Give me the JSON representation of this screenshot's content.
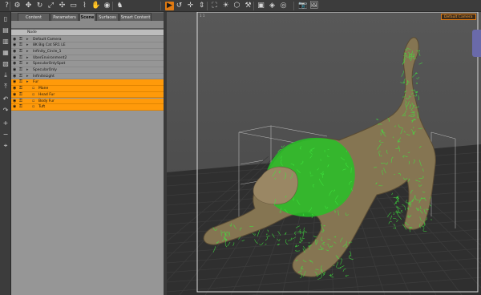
{
  "toolbar": {
    "icons": [
      "help-icon",
      "parameters-icon",
      "move-icon",
      "rotate-icon",
      "scale-icon",
      "universal-icon",
      "region-icon",
      "joint-icon",
      "grab-icon",
      "node-icon",
      "pose-icon",
      "active-tool-icon",
      "orbit-icon",
      "pan-icon",
      "dolly-icon",
      "frame-icon",
      "lights-icon",
      "render-icon",
      "render-settings-icon",
      "spot-render-icon",
      "iray-icon",
      "preview-icon",
      "camera-icon",
      "image-icon"
    ]
  },
  "left_strip": {
    "icons": [
      "new-scene-icon",
      "open-icon",
      "merge-icon",
      "save-icon",
      "save-as-icon",
      "import-icon",
      "export-icon",
      "undo-icon",
      "redo-icon",
      "zoom-in-icon",
      "zoom-out-icon",
      "fit-icon"
    ]
  },
  "tabs": [
    "Content Library",
    "Parameters",
    "Scene",
    "Surfaces",
    "Smart Content"
  ],
  "active_tab": "Scene",
  "scene": {
    "column_header": "Node",
    "rows": [
      {
        "label": "Default Camera",
        "indent": 0,
        "selected": false
      },
      {
        "label": "8K Big Cat SR1 LE",
        "indent": 0,
        "selected": false
      },
      {
        "label": "Infinity_Circle_1",
        "indent": 0,
        "selected": false
      },
      {
        "label": "UberEnvironment2",
        "indent": 0,
        "selected": false
      },
      {
        "label": "SpecularOnlySpot",
        "indent": 0,
        "selected": false
      },
      {
        "label": "SpecularOnly",
        "indent": 0,
        "selected": false
      },
      {
        "label": "InfiniteLight",
        "indent": 0,
        "selected": false
      },
      {
        "label": "Fur",
        "indent": 0,
        "selected": true
      },
      {
        "label": "Mane",
        "indent": 1,
        "selected": true
      },
      {
        "label": "Head Fur",
        "indent": 1,
        "selected": true
      },
      {
        "label": "Body Fur",
        "indent": 1,
        "selected": true
      },
      {
        "label": "Tuft",
        "indent": 1,
        "selected": true
      }
    ]
  },
  "viewport": {
    "camera_label": "Default Camera",
    "corner_label": "1 1",
    "colors": {
      "fur": "#2ed62e",
      "body": "#8a7a5a",
      "grid": "#3a3a3a",
      "floor": "#2e2e2e",
      "sky": "#5a5a5a",
      "accent": "#e07a12"
    }
  }
}
